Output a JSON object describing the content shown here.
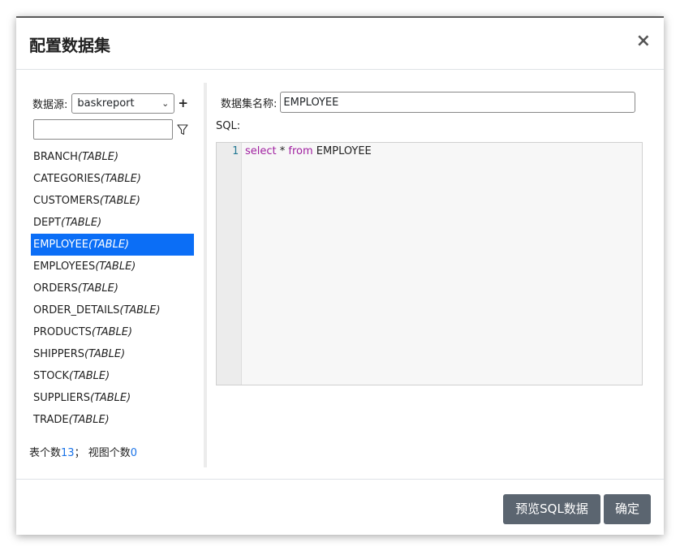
{
  "dialog": {
    "title": "配置数据集",
    "close_label": "×"
  },
  "datasource": {
    "label": "数据源:",
    "selected": "baskreport",
    "add_label": "+"
  },
  "filter": {
    "value": "",
    "icon": "filter-icon"
  },
  "tables": [
    {
      "name": "BRANCH",
      "type": "(TABLE)",
      "selected": false
    },
    {
      "name": "CATEGORIES",
      "type": "(TABLE)",
      "selected": false
    },
    {
      "name": "CUSTOMERS",
      "type": "(TABLE)",
      "selected": false
    },
    {
      "name": "DEPT",
      "type": "(TABLE)",
      "selected": false
    },
    {
      "name": "EMPLOYEE",
      "type": "(TABLE)",
      "selected": true
    },
    {
      "name": "EMPLOYEES",
      "type": "(TABLE)",
      "selected": false
    },
    {
      "name": "ORDERS",
      "type": "(TABLE)",
      "selected": false
    },
    {
      "name": "ORDER_DETAILS",
      "type": "(TABLE)",
      "selected": false
    },
    {
      "name": "PRODUCTS",
      "type": "(TABLE)",
      "selected": false
    },
    {
      "name": "SHIPPERS",
      "type": "(TABLE)",
      "selected": false
    },
    {
      "name": "STOCK",
      "type": "(TABLE)",
      "selected": false
    },
    {
      "name": "SUPPLIERS",
      "type": "(TABLE)",
      "selected": false
    },
    {
      "name": "TRADE",
      "type": "(TABLE)",
      "selected": false
    }
  ],
  "counts": {
    "table_label": "表个数",
    "table_count": "13",
    "separator": "；",
    "view_label": "视图个数",
    "view_count": "0"
  },
  "dataset": {
    "name_label": "数据集名称:",
    "name_value": "EMPLOYEE",
    "sql_label": "SQL:",
    "line_number": "1",
    "sql_kw1": "select",
    "sql_mid": " * ",
    "sql_kw2": "from",
    "sql_rest": " EMPLOYEE"
  },
  "footer": {
    "preview_label": "预览SQL数据",
    "ok_label": "确定"
  },
  "colors": {
    "selection": "#0b6ef6",
    "button": "#5b6570",
    "count_link": "#1a73e8",
    "sql_keyword": "#a020a0"
  }
}
